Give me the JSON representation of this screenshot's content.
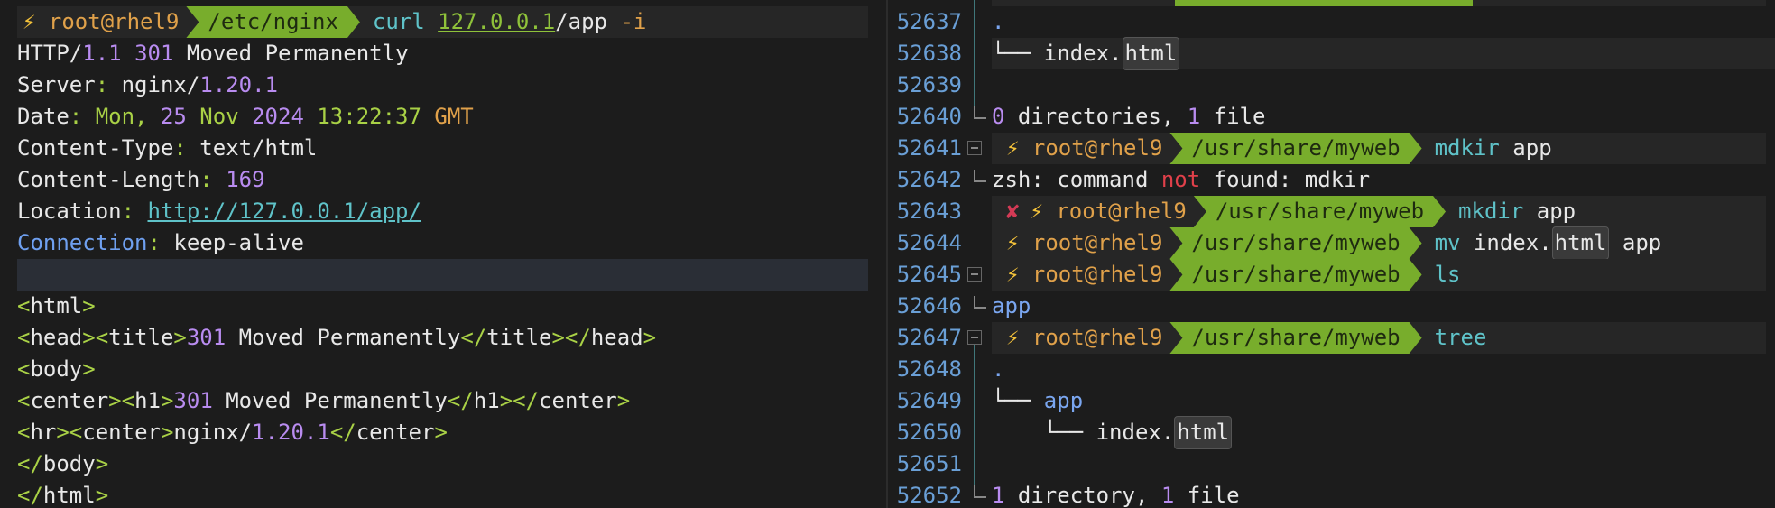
{
  "left": {
    "prompt": {
      "bolt": "⚡",
      "user": "root@rhel9",
      "path": "/etc/nginx",
      "cmd": "curl",
      "arg": "127.0.0.1",
      "arg_rest": "/app",
      "flag": "-i"
    },
    "status": {
      "proto": "HTTP/",
      "ver": "1.1",
      "code": "301",
      "text": "Moved Permanently"
    },
    "server": {
      "key": "Server",
      "sep": ": ",
      "name": "nginx/",
      "ver": "1.20.1"
    },
    "date": {
      "key": "Date",
      "sep": ": ",
      "val1": "Mon, ",
      "day": "25",
      "val2": " Nov ",
      "year": "2024",
      "time": "13:22:37",
      "gmt": "GMT"
    },
    "ctype": {
      "key": "Content-Type",
      "sep": ": ",
      "val": "text/html"
    },
    "clen": {
      "key": "Content-Length",
      "sep": ": ",
      "val": "169"
    },
    "loc": {
      "key": "Location",
      "sep": ": ",
      "val": "http://127.0.0.1/app/"
    },
    "conn": {
      "key": "Connection",
      "sep": ": ",
      "val": "keep-alive"
    },
    "html_lines": {
      "l1": {
        "open": "<",
        "name": "html",
        "close": ">"
      },
      "l2": {
        "a": "<",
        "b": "head",
        "c": "><",
        "d": "title",
        "e": ">",
        "num": "301",
        "text": " Moved Permanently",
        "f": "</",
        "g": "title",
        "h": "></",
        "i": "head",
        "j": ">"
      },
      "l3": {
        "open": "<",
        "name": "body",
        "close": ">"
      },
      "l4": {
        "a": "<",
        "b": "center",
        "c": "><",
        "d": "h1",
        "e": ">",
        "num": "301",
        "text": " Moved Permanently",
        "f": "</",
        "g": "h1",
        "h": "></",
        "i": "center",
        "j": ">"
      },
      "l5": {
        "a": "<",
        "b": "hr",
        "c": "><",
        "d": "center",
        "e": ">",
        "text": "nginx/",
        "num": "1.20.1",
        "f": "</",
        "g": "center",
        "h": ">"
      },
      "l6": {
        "open": "</",
        "name": "body",
        "close": ">"
      },
      "l7": {
        "open": "</",
        "name": "html",
        "close": ">"
      }
    }
  },
  "right": {
    "line_numbers": [
      "52637",
      "52638",
      "52639",
      "52640",
      "52641",
      "52642",
      "52643",
      "52644",
      "52645",
      "52646",
      "52647",
      "52648",
      "52649",
      "52650",
      "52651",
      "52652"
    ],
    "l52637": ".",
    "l52638": {
      "branch": "└── ",
      "name": "index.",
      "ext": "html"
    },
    "l52640": {
      "n1": "0",
      "t1": " directories, ",
      "n2": "1",
      "t2": " file"
    },
    "p52641": {
      "bolt": "⚡",
      "user": "root@rhel9",
      "path": "/usr/share/myweb",
      "cmd": "mdkir",
      "arg": " app"
    },
    "l52642": {
      "a": "zsh: command ",
      "b": "not",
      "c": " found: mdkir"
    },
    "p52643": {
      "err": "✘",
      "bolt": "⚡",
      "user": "root@rhel9",
      "path": "/usr/share/myweb",
      "cmd": "mkdir",
      "arg": " app"
    },
    "p52644": {
      "bolt": "⚡",
      "user": "root@rhel9",
      "path": "/usr/share/myweb",
      "cmd": "mv",
      "arg1": " index.",
      "ext": "html",
      "arg2": " app"
    },
    "p52645": {
      "bolt": "⚡",
      "user": "root@rhel9",
      "path": "/usr/share/myweb",
      "cmd": "ls"
    },
    "l52646": "app",
    "p52647": {
      "bolt": "⚡",
      "user": "root@rhel9",
      "path": "/usr/share/myweb",
      "cmd": "tree"
    },
    "l52648": ".",
    "l52649": {
      "branch": "└── ",
      "name": "app"
    },
    "l52650": {
      "branch": "    └── ",
      "name": "index.",
      "ext": "html"
    },
    "l52652": {
      "n1": "1",
      "t1": " directory, ",
      "n2": "1",
      "t2": " file"
    }
  }
}
